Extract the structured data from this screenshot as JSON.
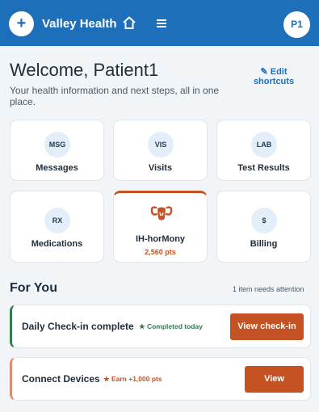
{
  "header": {
    "add_icon": "+",
    "brand": "Valley Health",
    "avatar": "P1",
    "colors": {
      "bar": "#1d6fba",
      "accent": "#c45223"
    }
  },
  "welcome": {
    "title": "Welcome, Patient1",
    "subtitle": "Your health information and next steps, all in one place.",
    "edit": "✎ Edit shortcuts"
  },
  "tiles": [
    {
      "badge": "MSG",
      "label": "Messages"
    },
    {
      "badge": "VIS",
      "label": "Visits"
    },
    {
      "badge": "LAB",
      "label": "Test Results"
    },
    {
      "badge": "RX",
      "label": "Medications"
    },
    {
      "label": "IH-horMony",
      "points": "2,560 pts",
      "logo": "ram-head-logo"
    },
    {
      "badge": "$",
      "label": "Billing"
    }
  ],
  "for_you": {
    "heading": "For You",
    "attention": "1 item needs attention",
    "items": [
      {
        "title": "Daily Check-in complete",
        "status": "★ Completed today",
        "cta": "View check-in"
      },
      {
        "title": "Connect Devices",
        "status": "★ Earn +1,000 pts",
        "cta": "View"
      }
    ]
  }
}
